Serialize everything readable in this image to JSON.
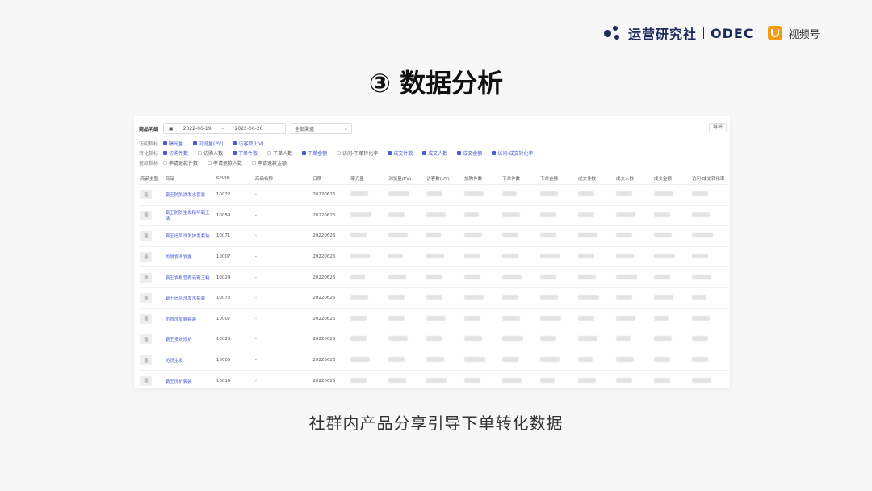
{
  "brand": {
    "name": "运营研究社",
    "partner": "ODEC",
    "channel": "视频号",
    "accent": "#1d2a5c"
  },
  "title": "③ 数据分析",
  "caption": "社群内产品分享引导下单转化数据",
  "dashboard": {
    "filter_label": "商品明细",
    "date_icon": "calendar-icon",
    "date_start": "2022-06-19",
    "date_sep": "~",
    "date_end": "2022-06-26",
    "channel_select": "全部渠道",
    "export_label": "导出",
    "metric_groups": [
      {
        "label": "访问指标",
        "items": [
          {
            "text": "曝光量",
            "on": true
          },
          {
            "text": "浏览量(PV)",
            "on": true
          },
          {
            "text": "访客数(UV)",
            "on": true
          }
        ]
      },
      {
        "label": "转化指标",
        "items": [
          {
            "text": "访购件数",
            "on": true
          },
          {
            "text": "访购人数",
            "on": false
          },
          {
            "text": "下单件数",
            "on": true
          },
          {
            "text": "下单人数",
            "on": false
          },
          {
            "text": "下单金额",
            "on": true
          },
          {
            "text": "访问-下单转化率",
            "on": false
          },
          {
            "text": "成交件数",
            "on": true
          },
          {
            "text": "成交人数",
            "on": true
          },
          {
            "text": "成交金额",
            "on": true
          },
          {
            "text": "访问-成交转化率",
            "on": true
          }
        ]
      },
      {
        "label": "退款指标",
        "items": [
          {
            "text": "申请退款件数",
            "on": false
          },
          {
            "text": "申请退款人数",
            "on": false
          },
          {
            "text": "申请退款金额",
            "on": false
          }
        ]
      }
    ],
    "columns": [
      "商品主图",
      "商品",
      "SPUID",
      "商品名称",
      "日期",
      "曝光量",
      "浏览量(PV)",
      "访客数(UV)",
      "加购件数",
      "下单件数",
      "下单金额",
      "成交件数",
      "成交人数",
      "成交金额",
      "访问-成交转化率"
    ],
    "rows": [
      {
        "thumb": "图",
        "name": "霸王防脱洗发水套装",
        "spuid": "10022",
        "product": "-",
        "date": "20220626"
      },
      {
        "thumb": "图",
        "name": "霸王防脱生发精华霸王精",
        "spuid": "10059",
        "product": "-",
        "date": "20220626"
      },
      {
        "thumb": "图",
        "name": "霸王追风洗发护发套装",
        "spuid": "10071",
        "product": "-",
        "date": "20220626"
      },
      {
        "thumb": "图",
        "name": "防脱发洗发露",
        "spuid": "10007",
        "product": "-",
        "date": "20220626"
      },
      {
        "thumb": "图",
        "name": "霸王发根营养液霸王精",
        "spuid": "10024",
        "product": "-",
        "date": "20220626"
      },
      {
        "thumb": "图",
        "name": "霸王追风洗发水套装",
        "spuid": "10073",
        "product": "-",
        "date": "20220626"
      },
      {
        "thumb": "图",
        "name": "防脱洗发露套装",
        "spuid": "10007",
        "product": "-",
        "date": "20220626"
      },
      {
        "thumb": "图",
        "name": "霸王多效修护",
        "spuid": "10025",
        "product": "-",
        "date": "20220626"
      },
      {
        "thumb": "图",
        "name": "防脱生发",
        "spuid": "10005",
        "product": "-",
        "date": "20220626"
      },
      {
        "thumb": "图",
        "name": "霸王洗护套装",
        "spuid": "10019",
        "product": "-",
        "date": "20220626"
      }
    ]
  }
}
